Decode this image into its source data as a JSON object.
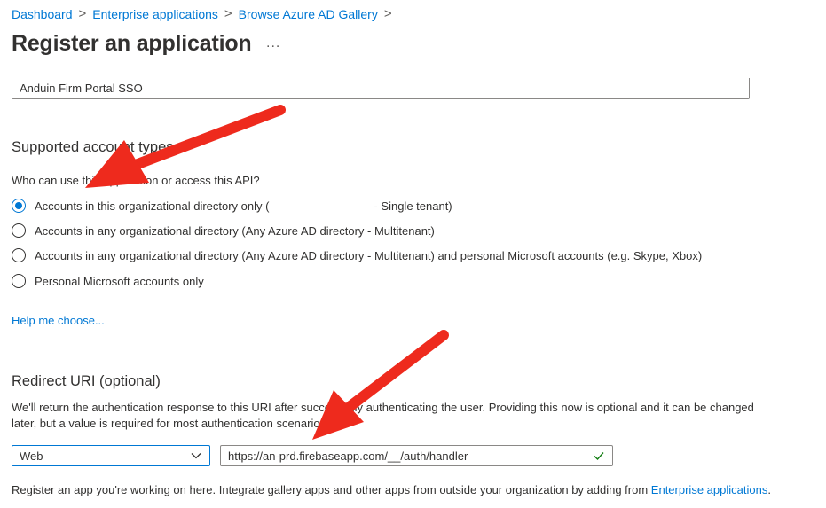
{
  "breadcrumb": {
    "items": [
      "Dashboard",
      "Enterprise applications",
      "Browse Azure AD Gallery"
    ],
    "separator": ">"
  },
  "page": {
    "title": "Register an application",
    "more": "..."
  },
  "name_field": {
    "value": "Anduin Firm Portal SSO"
  },
  "account_types": {
    "heading": "Supported account types",
    "question": "Who can use this application or access this API?",
    "options": [
      {
        "label_start": "Accounts in this organizational directory only (",
        "label_end": "- Single tenant)",
        "selected": true
      },
      {
        "label": "Accounts in any organizational directory (Any Azure AD directory - Multitenant)",
        "selected": false
      },
      {
        "label": "Accounts in any organizational directory (Any Azure AD directory - Multitenant) and personal Microsoft accounts (e.g. Skype, Xbox)",
        "selected": false
      },
      {
        "label": "Personal Microsoft accounts only",
        "selected": false
      }
    ],
    "help_link": "Help me choose..."
  },
  "redirect": {
    "heading": "Redirect URI (optional)",
    "description": "We'll return the authentication response to this URI after successfully authenticating the user. Providing this now is optional and it can be changed later, but a value is required for most authentication scenarios.",
    "platform": "Web",
    "uri_value": "https://an-prd.firebaseapp.com/__/auth/handler"
  },
  "footer": {
    "text": "Register an app you're working on here. Integrate gallery apps and other apps from outside your organization by adding from ",
    "link": "Enterprise applications",
    "end": "."
  },
  "colors": {
    "link": "#0078d4",
    "annotation_arrow": "#ee2a1d",
    "valid_check": "#107c10"
  },
  "icons": [
    "chevron-down-icon",
    "checkmark-icon"
  ]
}
